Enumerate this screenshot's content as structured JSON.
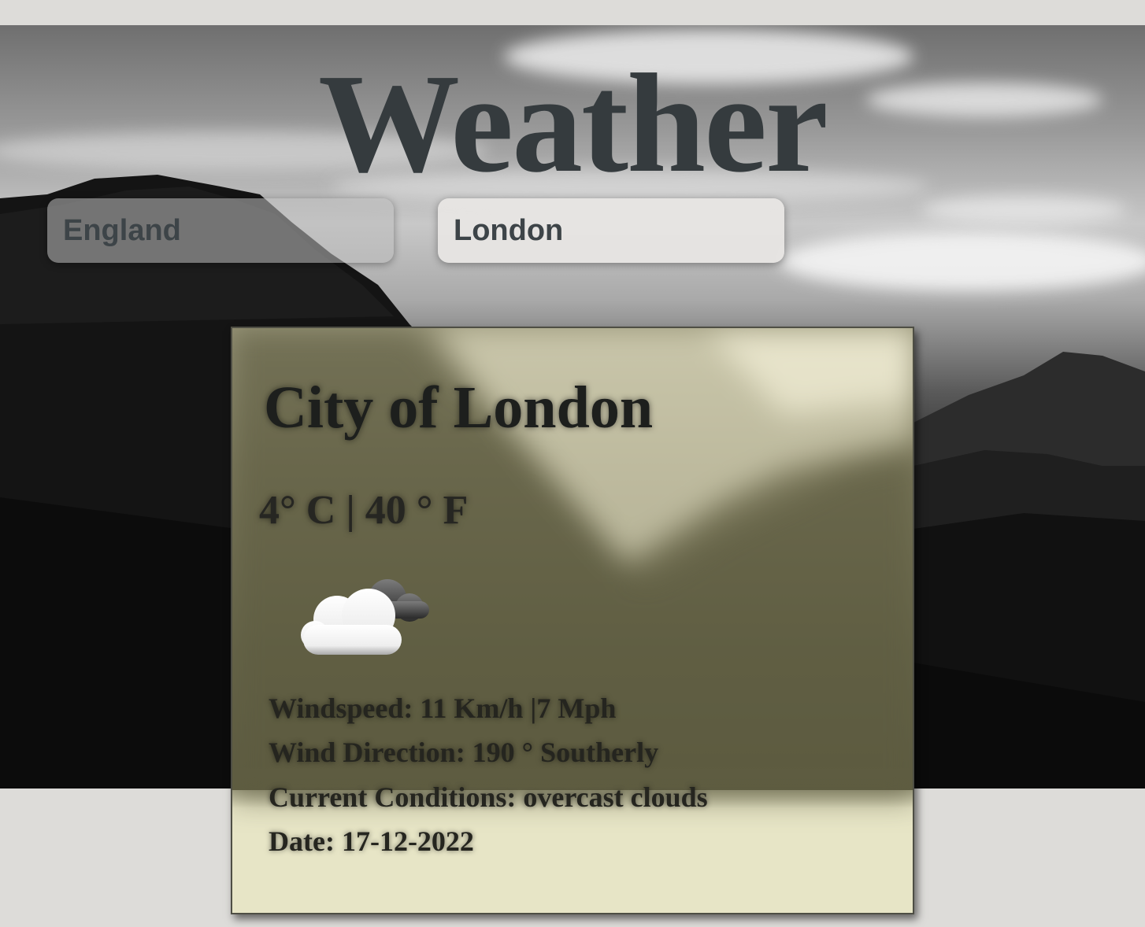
{
  "header": {
    "title": "Weather"
  },
  "search": {
    "country_value": "England",
    "city_value": "London"
  },
  "result": {
    "city_name": "City of London",
    "temperature": "4° C | 40 ° F",
    "icon": "cloud-icon",
    "windspeed": "Windspeed: 11 Km/h |7 Mph",
    "wind_direction": "Wind Direction: 190 ° Southerly",
    "conditions": "Current Conditions: overcast clouds",
    "date": "Date: 17-12-2022"
  },
  "colors": {
    "page_bg": "#dddcd9",
    "title": "#353b3e",
    "card_bg": "#e7e5c6",
    "card_shade": "#676549"
  }
}
